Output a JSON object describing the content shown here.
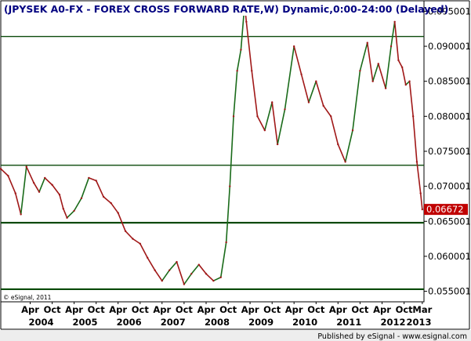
{
  "chart_data": {
    "type": "line",
    "title": "(JPYSEK A0-FX - FOREX CROSS FORWARD RATE,W) Dynamic,0:00-24:00 (Delayed)",
    "copyright": "© eSignal, 2011",
    "footer": "Published by eSignal - www.esignal.com",
    "last_value_label": "0.06672",
    "ylim": [
      0.0535,
      0.0965
    ],
    "y_ticks": [
      {
        "value": 0.055,
        "label": "0.055001"
      },
      {
        "value": 0.06,
        "label": "0.060001"
      },
      {
        "value": 0.065,
        "label": "0.065001"
      },
      {
        "value": 0.07,
        "label": "0.070001"
      },
      {
        "value": 0.075,
        "label": "0.075001"
      },
      {
        "value": 0.08,
        "label": "0.080001"
      },
      {
        "value": 0.085,
        "label": "0.085001"
      },
      {
        "value": 0.09,
        "label": "0.090001"
      },
      {
        "value": 0.095,
        "label": "0.095001"
      }
    ],
    "x_range": [
      "2003-08-01",
      "2013-03-15"
    ],
    "month_ticks": [
      {
        "date": "2004-04-01",
        "label": "Apr"
      },
      {
        "date": "2004-10-01",
        "label": "Oct"
      },
      {
        "date": "2005-04-01",
        "label": "Apr"
      },
      {
        "date": "2005-10-01",
        "label": "Oct"
      },
      {
        "date": "2006-04-01",
        "label": "Apr"
      },
      {
        "date": "2006-10-01",
        "label": "Oct"
      },
      {
        "date": "2007-04-01",
        "label": "Apr"
      },
      {
        "date": "2007-10-01",
        "label": "Oct"
      },
      {
        "date": "2008-04-01",
        "label": "Apr"
      },
      {
        "date": "2008-10-01",
        "label": "Oct"
      },
      {
        "date": "2009-04-01",
        "label": "Apr"
      },
      {
        "date": "2009-10-01",
        "label": "Oct"
      },
      {
        "date": "2010-04-01",
        "label": "Apr"
      },
      {
        "date": "2010-10-01",
        "label": "Oct"
      },
      {
        "date": "2011-04-01",
        "label": "Apr"
      },
      {
        "date": "2011-10-01",
        "label": "Oct"
      },
      {
        "date": "2012-04-01",
        "label": "Apr"
      },
      {
        "date": "2012-10-01",
        "label": "Oct"
      },
      {
        "date": "2013-03-01",
        "label": "Mar"
      }
    ],
    "year_ticks": [
      {
        "date": "2004-07-01",
        "label": "2004"
      },
      {
        "date": "2005-07-01",
        "label": "2005"
      },
      {
        "date": "2006-07-01",
        "label": "2006"
      },
      {
        "date": "2007-07-01",
        "label": "2007"
      },
      {
        "date": "2008-07-01",
        "label": "2008"
      },
      {
        "date": "2009-07-01",
        "label": "2009"
      },
      {
        "date": "2010-07-01",
        "label": "2010"
      },
      {
        "date": "2011-07-01",
        "label": "2011"
      },
      {
        "date": "2012-07-01",
        "label": "2012"
      },
      {
        "date": "2013-02-01",
        "label": "2013"
      }
    ],
    "horizontal_lines": [
      {
        "value": 0.0914,
        "weight": "thin"
      },
      {
        "value": 0.073,
        "weight": "thin"
      },
      {
        "value": 0.0648,
        "weight": "thick"
      },
      {
        "value": 0.0553,
        "weight": "thick"
      }
    ],
    "series": [
      {
        "points": [
          [
            "2003-08-01",
            0.0725
          ],
          [
            "2003-10-01",
            0.0715
          ],
          [
            "2003-12-01",
            0.069
          ],
          [
            "2004-01-15",
            0.066
          ],
          [
            "2004-03-01",
            0.0728
          ],
          [
            "2004-05-01",
            0.0705
          ],
          [
            "2004-06-15",
            0.0692
          ],
          [
            "2004-08-01",
            0.0712
          ],
          [
            "2004-10-01",
            0.0702
          ],
          [
            "2004-12-01",
            0.0688
          ],
          [
            "2005-01-01",
            0.0668
          ],
          [
            "2005-02-01",
            0.0655
          ],
          [
            "2005-04-01",
            0.0665
          ],
          [
            "2005-06-01",
            0.0683
          ],
          [
            "2005-08-01",
            0.0712
          ],
          [
            "2005-10-01",
            0.0708
          ],
          [
            "2005-12-01",
            0.0685
          ],
          [
            "2006-02-01",
            0.0676
          ],
          [
            "2006-04-01",
            0.0662
          ],
          [
            "2006-06-01",
            0.0636
          ],
          [
            "2006-08-01",
            0.0625
          ],
          [
            "2006-10-01",
            0.0618
          ],
          [
            "2006-12-01",
            0.0598
          ],
          [
            "2007-02-01",
            0.058
          ],
          [
            "2007-04-01",
            0.0565
          ],
          [
            "2007-06-01",
            0.058
          ],
          [
            "2007-08-01",
            0.0592
          ],
          [
            "2007-10-01",
            0.056
          ],
          [
            "2007-12-01",
            0.0575
          ],
          [
            "2008-02-01",
            0.0588
          ],
          [
            "2008-04-01",
            0.0575
          ],
          [
            "2008-06-01",
            0.0565
          ],
          [
            "2008-08-01",
            0.057
          ],
          [
            "2008-09-15",
            0.062
          ],
          [
            "2008-10-15",
            0.07
          ],
          [
            "2008-11-15",
            0.08
          ],
          [
            "2008-12-15",
            0.0865
          ],
          [
            "2009-01-15",
            0.0895
          ],
          [
            "2009-02-15",
            0.096
          ],
          [
            "2009-03-01",
            0.0935
          ],
          [
            "2009-04-15",
            0.0865
          ],
          [
            "2009-06-01",
            0.08
          ],
          [
            "2009-08-01",
            0.078
          ],
          [
            "2009-10-01",
            0.082
          ],
          [
            "2009-11-15",
            0.076
          ],
          [
            "2010-01-15",
            0.081
          ],
          [
            "2010-04-01",
            0.09
          ],
          [
            "2010-06-01",
            0.086
          ],
          [
            "2010-08-01",
            0.082
          ],
          [
            "2010-10-01",
            0.085
          ],
          [
            "2010-12-01",
            0.0815
          ],
          [
            "2011-02-01",
            0.08
          ],
          [
            "2011-04-01",
            0.076
          ],
          [
            "2011-06-01",
            0.0735
          ],
          [
            "2011-08-01",
            0.078
          ],
          [
            "2011-10-01",
            0.0865
          ],
          [
            "2011-12-01",
            0.0905
          ],
          [
            "2012-01-15",
            0.085
          ],
          [
            "2012-03-01",
            0.0875
          ],
          [
            "2012-05-01",
            0.084
          ],
          [
            "2012-06-15",
            0.09
          ],
          [
            "2012-07-15",
            0.0935
          ],
          [
            "2012-08-15",
            0.088
          ],
          [
            "2012-09-15",
            0.087
          ],
          [
            "2012-10-15",
            0.0845
          ],
          [
            "2012-11-15",
            0.085
          ],
          [
            "2012-12-15",
            0.08
          ],
          [
            "2013-01-15",
            0.0735
          ],
          [
            "2013-02-15",
            0.069
          ],
          [
            "2013-03-01",
            0.0667
          ]
        ]
      }
    ]
  },
  "style": {
    "background": "#FFFFFF",
    "frame": "#000000",
    "series_up": "#1A6B1A",
    "series_down": "#A01818",
    "level_line": "#0A4A0A",
    "last_value_bg": "#C00000",
    "last_value_fg": "#FFFFFF",
    "footer_bg": "#EDEDED",
    "title_color": "#000080"
  }
}
